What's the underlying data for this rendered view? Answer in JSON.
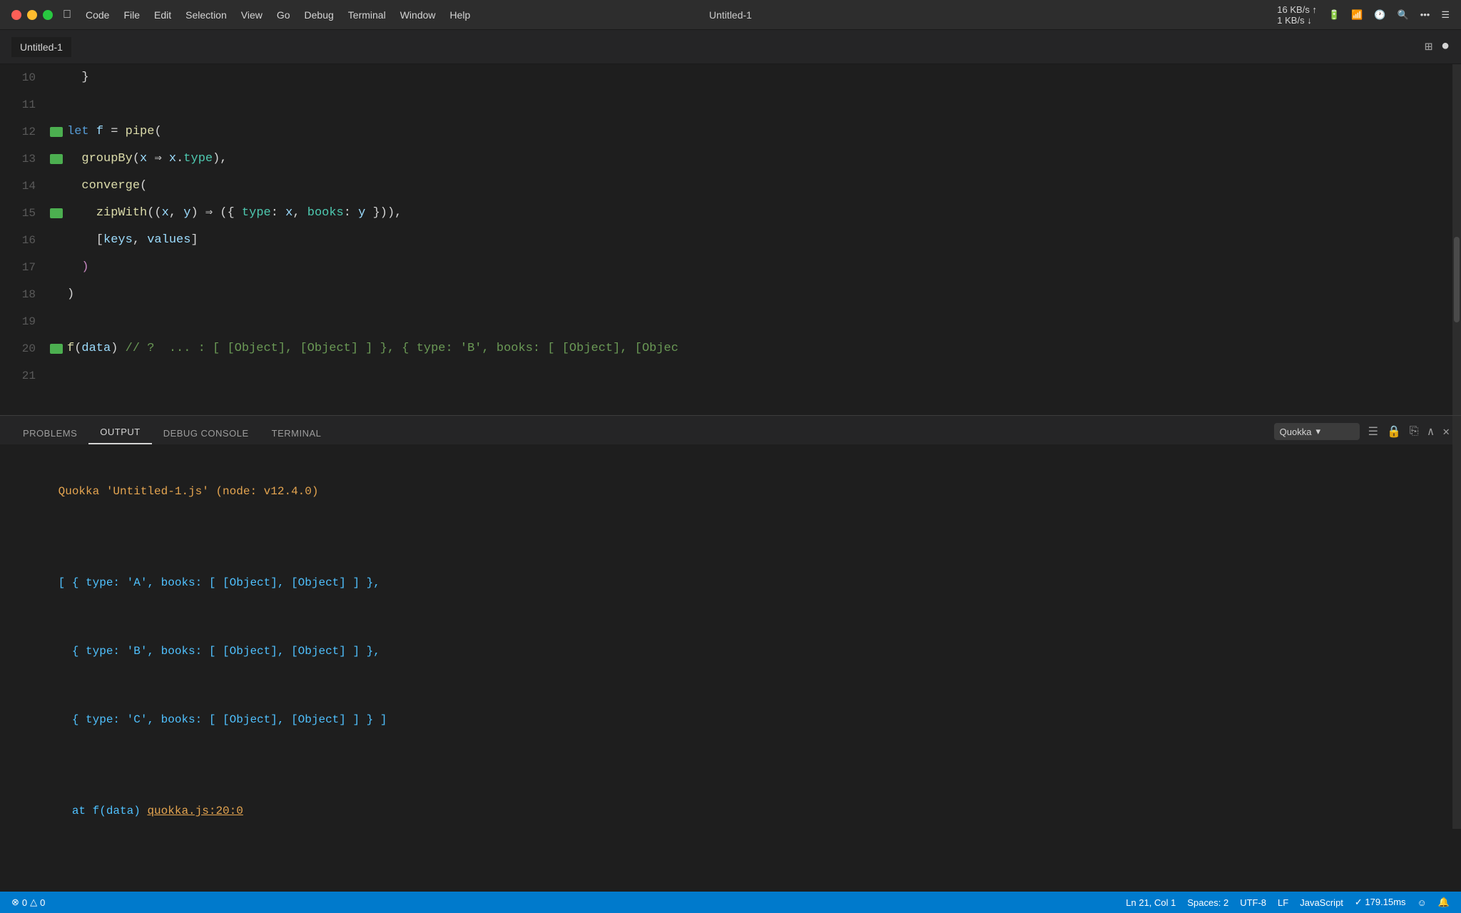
{
  "titlebar": {
    "title": "Untitled-1",
    "traffic_lights": [
      "red",
      "yellow",
      "green"
    ],
    "menu": [
      "",
      "Code",
      "File",
      "Edit",
      "Selection",
      "View",
      "Go",
      "Debug",
      "Terminal",
      "Window",
      "Help"
    ],
    "right_items": [
      "16 KB/s",
      "1 KB/s",
      "",
      "",
      "",
      "",
      ""
    ]
  },
  "tab": {
    "label": "Untitled-1"
  },
  "code_lines": [
    {
      "num": "10",
      "indicator": true,
      "content": "  }"
    },
    {
      "num": "11",
      "indicator": false,
      "content": ""
    },
    {
      "num": "12",
      "indicator": true,
      "content": "let f = pipe("
    },
    {
      "num": "13",
      "indicator": true,
      "content": "  groupBy(x => x.type),"
    },
    {
      "num": "14",
      "indicator": false,
      "content": "  converge("
    },
    {
      "num": "15",
      "indicator": true,
      "content": "    zipWith((x, y) => ({ type: x, books: y })),"
    },
    {
      "num": "16",
      "indicator": false,
      "content": "    [keys, values]"
    },
    {
      "num": "17",
      "indicator": false,
      "content": "  )"
    },
    {
      "num": "18",
      "indicator": false,
      "content": ")"
    },
    {
      "num": "19",
      "indicator": false,
      "content": ""
    },
    {
      "num": "20",
      "indicator": true,
      "content": "f(data) // ?  ... : [ [Object], [Object] ] }, { type: 'B', books: [ [Object], [Objec"
    },
    {
      "num": "21",
      "indicator": false,
      "content": ""
    }
  ],
  "panel": {
    "tabs": [
      "PROBLEMS",
      "OUTPUT",
      "DEBUG CONSOLE",
      "TERMINAL"
    ],
    "active_tab": "OUTPUT",
    "dropdown_label": "Quokka",
    "output_lines": [
      {
        "type": "header",
        "text": "Quokka 'Untitled-1.js' (node: v12.4.0)"
      },
      {
        "type": "empty",
        "text": ""
      },
      {
        "type": "output",
        "text": "[ { type: 'A', books: [ [Object], [Object] ] },"
      },
      {
        "type": "output",
        "text": "  { type: 'B', books: [ [Object], [Object] ] },"
      },
      {
        "type": "output",
        "text": "  { type: 'C', books: [ [Object], [Object] ] } ]"
      },
      {
        "type": "empty",
        "text": ""
      },
      {
        "type": "at",
        "text": "  at f(data) "
      },
      {
        "type": "link",
        "text": "quokka.js:20:0"
      }
    ]
  },
  "statusbar": {
    "errors": "0",
    "warnings": "0",
    "position": "Ln 21, Col 1",
    "spaces": "Spaces: 2",
    "encoding": "UTF-8",
    "line_ending": "LF",
    "language": "JavaScript",
    "timing": "✓ 179.15ms"
  }
}
